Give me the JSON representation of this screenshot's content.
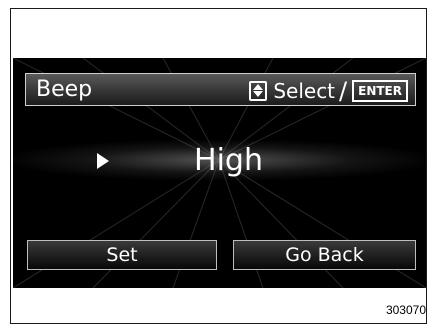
{
  "header": {
    "title": "Beep",
    "select_label": "Select",
    "separator": "/",
    "enter_label": "ENTER",
    "updown_icon": "up-down-icon"
  },
  "value": {
    "current": "High",
    "arrow_icon": "arrow-right-icon"
  },
  "buttons": {
    "set_label": "Set",
    "back_label": "Go Back"
  },
  "figure_code": "303070",
  "colors": {
    "screen_background": "#000000",
    "text": "#ffffff",
    "button_border": "#bdbdbd"
  }
}
